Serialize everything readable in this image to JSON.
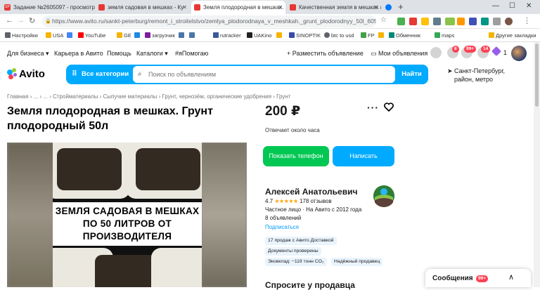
{
  "browser": {
    "tabs": [
      {
        "label": "Задание №2605097 - просмотр",
        "color": "#e53935",
        "icon_text": "SP"
      },
      {
        "label": "земля садовая в мешках - Ку",
        "color": "#e53935"
      },
      {
        "label": "Земля плодородная в мешках. Гр",
        "color": "#e53935"
      },
      {
        "label": "Качественная земля в мешках / ",
        "color": "#e53935"
      },
      {
        "label": "",
        "color": "#0077ff"
      }
    ],
    "new_tab": "+",
    "url": "https://www.avito.ru/sankt-peterburg/remont_i_stroitelstvo/zemlya_plodorodnaya_v_meshkah._grunt_plodorodnyy_50l_60507..."
  },
  "bookmarks": [
    {
      "label": "Настройки",
      "icon": "gear-icon",
      "color": "#5f6368"
    },
    {
      "label": "USA",
      "icon": "folder-icon",
      "color": "#f4b400"
    },
    {
      "label": "",
      "icon": "google-icon",
      "color": "#4285f4"
    },
    {
      "label": "YouTube",
      "icon": "youtube-icon",
      "color": "#ff0000"
    },
    {
      "label": "GE",
      "icon": "folder-icon",
      "color": "#f4b400"
    },
    {
      "label": "",
      "icon": "cloud-icon",
      "color": "#1e88e5"
    },
    {
      "label": "загрузчик",
      "icon": "download-icon",
      "color": "#7b1fa2"
    },
    {
      "label": "",
      "icon": "vk-icon",
      "color": "#4a76a8"
    },
    {
      "label": "",
      "icon": "vk-icon",
      "color": "#4a76a8"
    },
    {
      "label": "rutracker",
      "icon": "rutracker-icon",
      "color": "#3b5998"
    },
    {
      "label": "UAKino",
      "icon": "uakino-icon",
      "color": "#222222"
    },
    {
      "label": "",
      "icon": "folder-icon",
      "color": "#f4b400"
    },
    {
      "label": "SINOPTIK",
      "icon": "sinoptik-icon",
      "color": "#3949ab"
    },
    {
      "label": "btc to usd",
      "icon": "globe-icon",
      "color": "#5f6368"
    },
    {
      "label": "FP",
      "icon": "fp-icon",
      "color": "#43a047"
    },
    {
      "label": "",
      "icon": "folder-icon",
      "color": "#f4b400"
    },
    {
      "label": "Обменник",
      "icon": "exchange-icon",
      "color": "#00897b"
    },
    {
      "label": "maps",
      "icon": "maps-icon",
      "color": "#34a853"
    },
    {
      "label": "Другие закладки",
      "icon": "folder-icon",
      "color": "#f4b400"
    }
  ],
  "header": {
    "links": [
      "Для бизнеса ▾",
      "Карьера в Авито",
      "Помощь",
      "Каталоги ▾",
      "#яПомогаю"
    ],
    "post_ad": "+ Разместить объявление",
    "my_ads": "Мои объявления",
    "badges": {
      "notifications": "8",
      "messages": "99+",
      "cart": "14",
      "bonus": "1"
    },
    "logo": "Avito",
    "categories": "Все категории",
    "search_placeholder": "Поиск по объявлениям",
    "search_button": "Найти",
    "location_line1": "Санкт-Петербург,",
    "location_line2": "район, метро",
    "accent": "#00aaff"
  },
  "breadcrumbs": "Главная › ... › ... › Стройматериалы › Сыпучие материалы › Грунт, чернозём, органические удобрения › Грунт",
  "listing": {
    "title": "Земля плодородная в мешках. Грунт плодородный 50л",
    "price": "200 ₽",
    "respond": "Отвечает около часа",
    "photo_text": "ЗЕМЛЯ САДОВАЯ В МЕШКАХ ПО 50 ЛИТРОВ ОТ ПРОИЗВОДИТЕЛЯ",
    "phone_button": "Показать телефон",
    "write_button": "Написать"
  },
  "seller": {
    "name": "Алексей Анатольевич",
    "rating": "4.7",
    "stars": "★★★★★",
    "reviews": "178 отзывов",
    "type": "Частное лицо · На Авито с 2012 года",
    "ads_count": "8 объявлений",
    "subscribe": "Подписаться",
    "chips": [
      "17 продаж с Авито Доставкой",
      "Документы проверены",
      "Эковклад: −119 тонн CO₂",
      "Надёжный продавец"
    ]
  },
  "ask_seller": "Спросите у продавца",
  "messages": {
    "label": "Сообщения",
    "count": "99+"
  }
}
